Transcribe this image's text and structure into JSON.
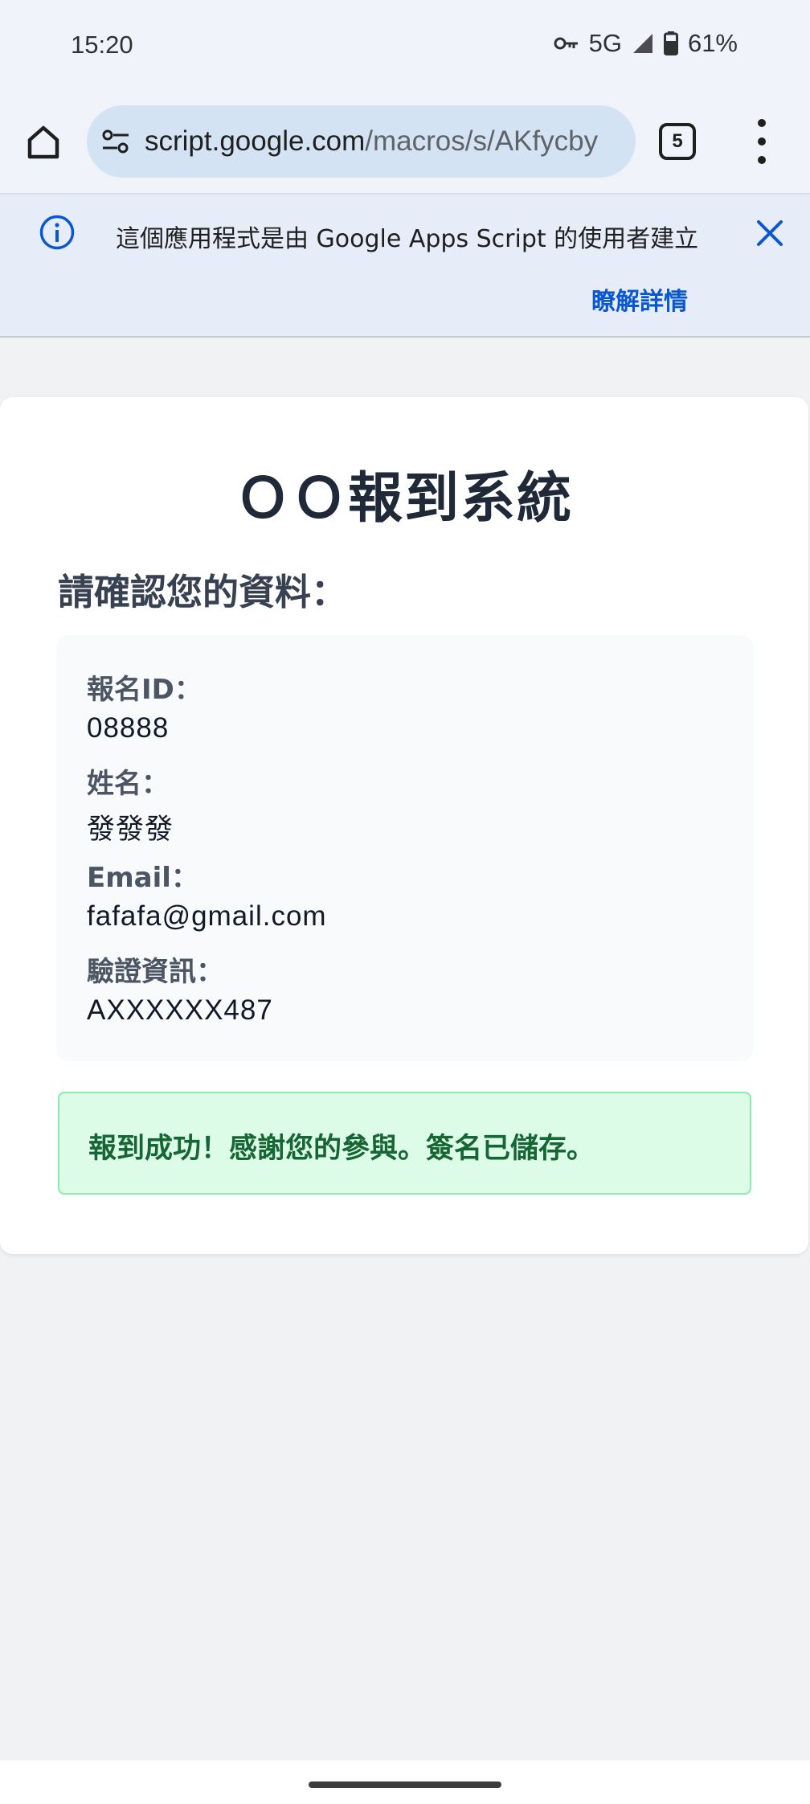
{
  "status_bar": {
    "time": "15:20",
    "network": "5G",
    "battery": "61%",
    "icons": [
      "vpn-key-icon",
      "signal-icon",
      "battery-icon"
    ]
  },
  "browser": {
    "url_host": "script.google.com",
    "url_path": "/macros/s/AKfycby",
    "tab_count": "5",
    "icons": [
      "home-icon",
      "site-settings-icon",
      "more-vert-icon"
    ]
  },
  "banner": {
    "message": "這個應用程式是由 Google Apps Script 的使用者建立",
    "link": "瞭解詳情",
    "icons": [
      "info-icon",
      "close-icon"
    ],
    "link_color": "#0b57d0"
  },
  "page": {
    "title": "ＯＯ報到系統",
    "confirm_heading": "請確認您的資料：",
    "fields": [
      {
        "label": "報名ID：",
        "value": "08888"
      },
      {
        "label": "姓名：",
        "value": "發發發"
      },
      {
        "label": "Email：",
        "value": "fafafa@gmail.com"
      },
      {
        "label": "驗證資訊：",
        "value": "AXXXXXX487"
      }
    ],
    "success_message": "報到成功！感謝您的參與。簽名已儲存。",
    "success_color": "#166534"
  }
}
